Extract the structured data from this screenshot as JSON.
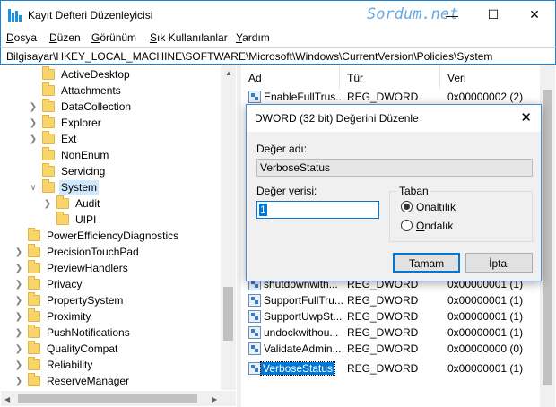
{
  "window": {
    "title": "Kayıt Defteri Düzenleyicisi",
    "watermark": "Sordum.net",
    "minimize_glyph": "—",
    "maximize_glyph": "☐",
    "close_glyph": "✕"
  },
  "menu": {
    "items": [
      {
        "u": "D",
        "rest": "osya"
      },
      {
        "u": "D",
        "rest": "üzen"
      },
      {
        "u": "G",
        "rest": "örünüm"
      },
      {
        "u": "S",
        "rest": "ık Kullanılanlar"
      },
      {
        "u": "Y",
        "rest": "ardım"
      }
    ]
  },
  "address": "Bilgisayar\\HKEY_LOCAL_MACHINE\\SOFTWARE\\Microsoft\\Windows\\CurrentVersion\\Policies\\System",
  "tree": {
    "items": [
      {
        "label": "ActiveDesktop"
      },
      {
        "label": "Attachments"
      },
      {
        "label": "DataCollection"
      },
      {
        "label": "Explorer"
      },
      {
        "label": "Ext"
      },
      {
        "label": "NonEnum"
      },
      {
        "label": "Servicing"
      },
      {
        "label": "System"
      },
      {
        "label": "Audit"
      },
      {
        "label": "UIPI"
      },
      {
        "label": "PowerEfficiencyDiagnostics"
      },
      {
        "label": "PrecisionTouchPad"
      },
      {
        "label": "PreviewHandlers"
      },
      {
        "label": "Privacy"
      },
      {
        "label": "PropertySystem"
      },
      {
        "label": "Proximity"
      },
      {
        "label": "PushNotifications"
      },
      {
        "label": "QualityCompat"
      },
      {
        "label": "Reliability"
      },
      {
        "label": "ReserveManager"
      }
    ]
  },
  "list": {
    "headers": {
      "name": "Ad",
      "type": "Tür",
      "data": "Veri"
    },
    "rows": [
      {
        "name": "EnableFullTrus...",
        "type": "REG_DWORD",
        "data": "0x00000002 (2)"
      },
      {
        "name": "shutdownwith...",
        "type": "REG_DWORD",
        "data": "0x00000001 (1)"
      },
      {
        "name": "SupportFullTru...",
        "type": "REG_DWORD",
        "data": "0x00000001 (1)"
      },
      {
        "name": "SupportUwpSt...",
        "type": "REG_DWORD",
        "data": "0x00000001 (1)"
      },
      {
        "name": "undockwithou...",
        "type": "REG_DWORD",
        "data": "0x00000001 (1)"
      },
      {
        "name": "ValidateAdmin...",
        "type": "REG_DWORD",
        "data": "0x00000000 (0)"
      },
      {
        "name": "VerboseStatus",
        "type": "REG_DWORD",
        "data": "0x00000001 (1)"
      }
    ]
  },
  "dialog": {
    "title": "DWORD (32 bit) Değerini Düzenle",
    "value_name_label": "Değer adı:",
    "value_name": "VerboseStatus",
    "value_data_label": "Değer verisi:",
    "value_data": "1",
    "base_label": "Taban",
    "base_hex": {
      "u": "O",
      "rest": "naltılık"
    },
    "base_dec": {
      "u": "O",
      "rest": "ndalık"
    },
    "ok_label": "Tamam",
    "cancel_label": "İptal",
    "close_glyph": "✕"
  }
}
